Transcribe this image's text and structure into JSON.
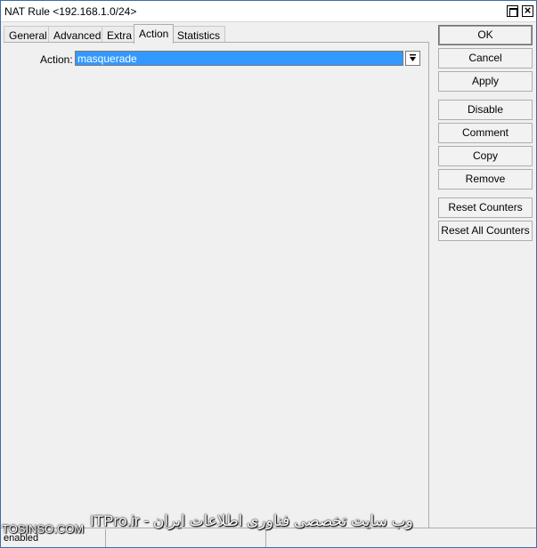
{
  "window": {
    "title": "NAT Rule <192.168.1.0/24>"
  },
  "tabs": [
    {
      "label": "General"
    },
    {
      "label": "Advanced"
    },
    {
      "label": "Extra"
    },
    {
      "label": "Action"
    },
    {
      "label": "Statistics"
    }
  ],
  "active_tab": "Action",
  "action": {
    "label": "Action:",
    "value": "masquerade"
  },
  "buttons": {
    "ok": "OK",
    "cancel": "Cancel",
    "apply": "Apply",
    "disable": "Disable",
    "comment": "Comment",
    "copy": "Copy",
    "remove": "Remove",
    "reset_counters": "Reset Counters",
    "reset_all_counters": "Reset All Counters"
  },
  "status": {
    "state": "enabled"
  },
  "watermark": {
    "site": "TOSINSO.COM",
    "tagline": "ITPro.ir - وب سایت تخصصی فناوری اطلاعات ایران"
  }
}
